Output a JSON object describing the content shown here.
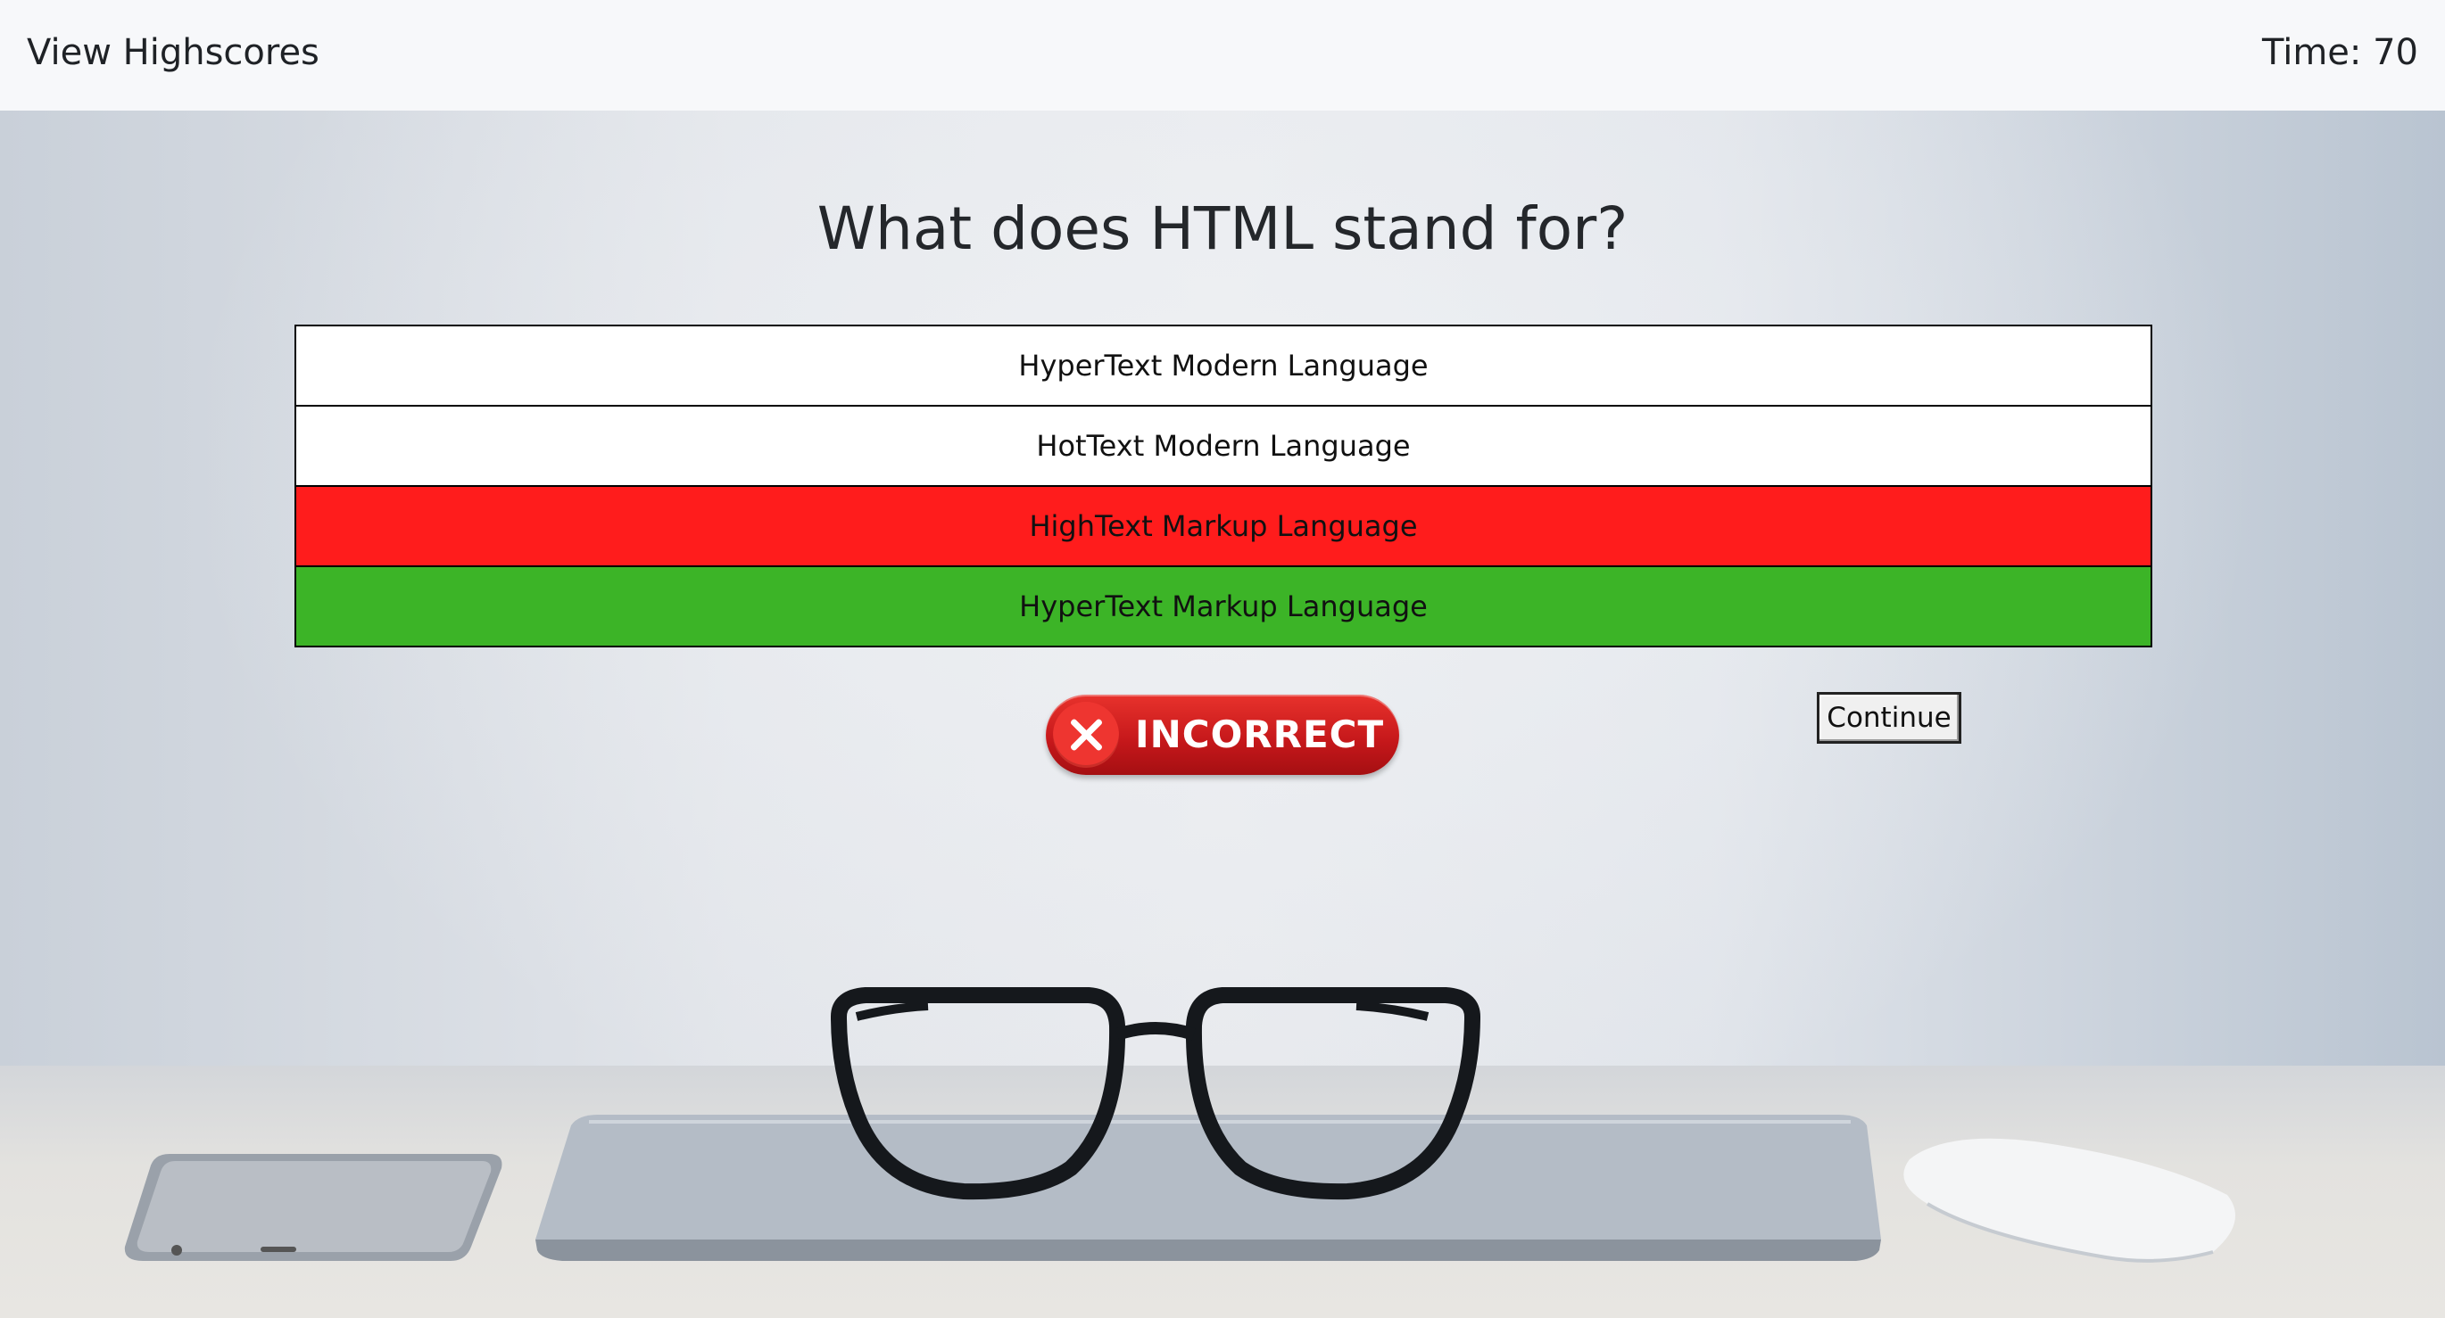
{
  "header": {
    "view_highscores": "View Highscores",
    "timer_label": "Time:",
    "timer_value": "70"
  },
  "quiz": {
    "question": "What does HTML stand for?",
    "answers": [
      {
        "label": "HyperText Modern Language",
        "state": "neutral"
      },
      {
        "label": "HotText Modern Language",
        "state": "neutral"
      },
      {
        "label": "HighText Markup Language",
        "state": "incorrect-selected"
      },
      {
        "label": "HyperText Markup Language",
        "state": "correct"
      }
    ],
    "result_badge": "INCORRECT",
    "continue_label": "Continue"
  },
  "colors": {
    "incorrect": "#ff1c1c",
    "correct": "#3cb427",
    "badge": "#c4171a"
  },
  "icons": {
    "result": "x-circle-icon"
  }
}
